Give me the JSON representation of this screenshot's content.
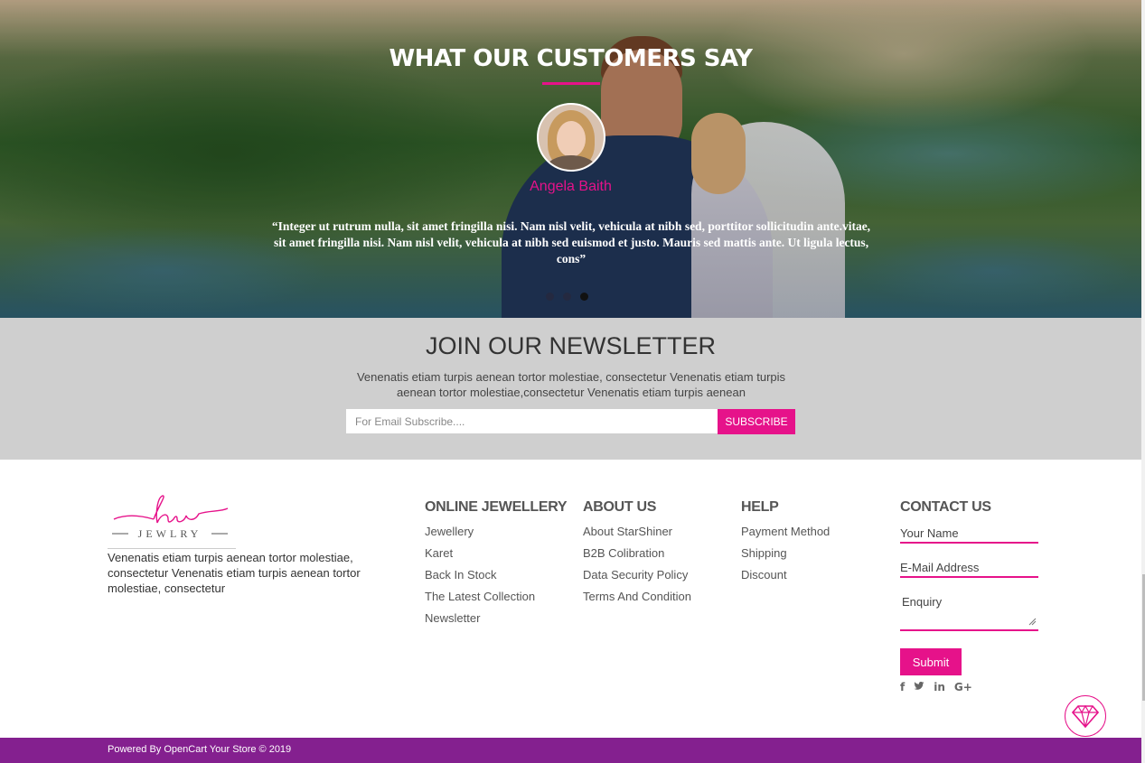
{
  "testimonials": {
    "title": "WHAT OUR CUSTOMERS SAY",
    "reviewer_name": "Angela Baith",
    "quote": "“Integer ut rutrum nulla, sit amet fringilla nisi. Nam nisl velit, vehicula at nibh sed, porttitor sollicitudin ante.vitae, sit amet fringilla nisi. Nam nisl velit, vehicula at nibh sed euismod et justo. Mauris sed mattis ante. Ut ligula lectus, cons”",
    "slides_count": 3,
    "active_slide": 3
  },
  "newsletter": {
    "title": "JOIN OUR NEWSLETTER",
    "description": "Venenatis etiam turpis aenean tortor molestiae, consectetur Venenatis etiam turpis aenean tortor molestiae,consectetur Venenatis etiam turpis aenean",
    "input_placeholder": "For Email Subscribe....",
    "input_value": "",
    "button_label": "SUBSCRIBE"
  },
  "footer": {
    "logo": {
      "script": "hu",
      "wordmark": "JEWLRY"
    },
    "about_text": "Venenatis etiam turpis aenean tortor molestiae, consectetur Venenatis etiam turpis aenean tortor molestiae, consectetur",
    "columns": [
      {
        "heading": "ONLINE JEWELLERY",
        "links": [
          "Jewellery",
          "Karet",
          "Back In Stock",
          "The Latest Collection",
          "Newsletter"
        ]
      },
      {
        "heading": "ABOUT US",
        "links": [
          "About StarShiner",
          "B2B Colibration",
          "Data Security Policy",
          "Terms And Condition"
        ]
      },
      {
        "heading": "HELP",
        "links": [
          "Payment Method",
          "Shipping",
          "Discount"
        ]
      }
    ],
    "contact": {
      "heading": "CONTACT US",
      "name_placeholder": "Your Name",
      "email_placeholder": "E-Mail Address",
      "enquiry_placeholder": "Enquiry",
      "submit_label": "Submit",
      "socials": [
        {
          "name": "facebook-icon",
          "glyph": "f"
        },
        {
          "name": "twitter-icon",
          "glyph": "🐦︎"
        },
        {
          "name": "linkedin-icon",
          "glyph": "in"
        },
        {
          "name": "google-plus-icon",
          "glyph": "G+"
        }
      ]
    }
  },
  "bottom_bar": {
    "copyright": "Powered By OpenCart Your Store © 2019"
  },
  "colors": {
    "accent": "#e6128a",
    "bottom_bar": "#84208f",
    "newsletter_bg": "#cfcfcf"
  }
}
